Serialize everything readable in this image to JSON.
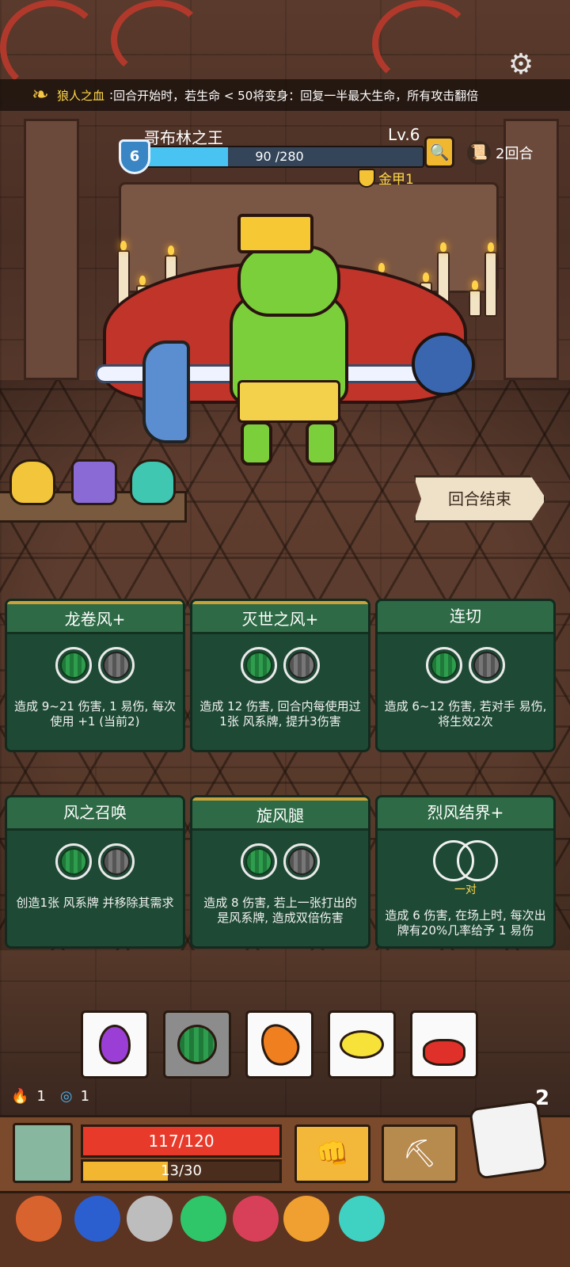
{
  "blessing": {
    "icon": "werewolf-blood-icon",
    "name": "狼人之血",
    "separator": ":",
    "description": "回合开始时，若生命 < 50将变身：回复一半最大生命，所有攻击翻倍"
  },
  "enemy": {
    "name": "哥布林之王",
    "level": "Lv.6",
    "shield_value": "6",
    "hp_text": "90 /280",
    "hp_current": 90,
    "hp_max": 280,
    "armor_label": "金甲1"
  },
  "turn_counter": {
    "label": "2回合",
    "icon": "scroll-icon"
  },
  "end_turn_button": "回合结束",
  "cards": [
    {
      "title": "龙卷风+",
      "slots": [
        "watermelon",
        "gray"
      ],
      "desc": "造成 9~21 伤害, 1 易伤, 每次使用 +1 (当前2)"
    },
    {
      "title": "灭世之风+",
      "slots": [
        "watermelon",
        "gray"
      ],
      "desc": "造成 12 伤害, 回合内每使用过1张 风系牌, 提升3伤害"
    },
    {
      "title": "连切",
      "slots": [
        "watermelon",
        "gray"
      ],
      "desc": "造成 6~12 伤害, 若对手 易伤, 将生效2次"
    },
    {
      "title": "风之召唤",
      "slots": [
        "watermelon",
        "gray"
      ],
      "desc": "创造1张 风系牌 并移除其需求"
    },
    {
      "title": "旋风腿",
      "slots": [
        "watermelon",
        "gray"
      ],
      "desc": "造成 8 伤害, 若上一张打出的是风系牌, 造成双倍伤害"
    },
    {
      "title": "烈风结界+",
      "slots": [
        "pair"
      ],
      "pair_label": "一对",
      "desc": "造成 6 伤害, 在场上时, 每次出牌有20%几率给予 1 易伤"
    }
  ],
  "dice": [
    {
      "fruit": "grape",
      "selected": false
    },
    {
      "fruit": "watermelon",
      "selected": true
    },
    {
      "fruit": "mango",
      "selected": false
    },
    {
      "fruit": "lemon",
      "selected": false
    },
    {
      "fruit": "cherry",
      "selected": false
    }
  ],
  "player": {
    "fire_count": "1",
    "spiral_count": "1",
    "dice_remaining": "2",
    "hp_text": "117/120",
    "hp_current": 117,
    "hp_max": 120,
    "xp_text": "13/30",
    "xp_current": 13,
    "xp_max": 30
  },
  "items": [
    "meat-icon",
    "blue-flame-icon",
    "gear-scroll-icon",
    "green-gem-icon",
    "red-amulet-icon",
    "feather-icon",
    "crystal-icon"
  ],
  "colors": {
    "card_green": "#1e4a35",
    "enemy_hp": "#49c4f2",
    "player_hp": "#e83a2a",
    "xp": "#f2b630",
    "gold_text": "#ffd84a"
  }
}
